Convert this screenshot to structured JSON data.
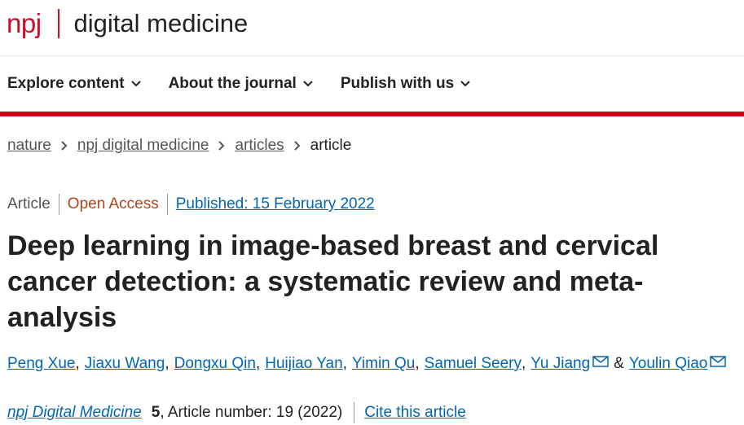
{
  "header": {
    "brand_short": "npj",
    "brand_name": "digital medicine"
  },
  "nav": {
    "items": [
      {
        "label": "Explore content"
      },
      {
        "label": "About the journal"
      },
      {
        "label": "Publish with us"
      }
    ]
  },
  "breadcrumb": {
    "items": [
      "nature",
      "npj digital medicine",
      "articles"
    ],
    "current": "article"
  },
  "meta": {
    "type": "Article",
    "access": "Open Access",
    "published": "Published: 15 February 2022"
  },
  "title": "Deep learning in image-based breast and cervical cancer detection: a systematic review and meta-analysis",
  "authors": [
    "Peng Xue",
    "Jiaxu Wang",
    "Dongxu Qin",
    "Huijiao Yan",
    "Yimin Qu",
    "Samuel Seery",
    "Yu Jiang",
    "Youlin Qiao"
  ],
  "authors_amp": "&",
  "citation": {
    "journal": "npj Digital Medicine",
    "volume": "5",
    "article": ", Article number: 19 (2022)",
    "cite_label": "Cite this article"
  },
  "colors": {
    "brand": "#c8102e",
    "link": "#0066b3",
    "open_access": "#b0451a"
  }
}
